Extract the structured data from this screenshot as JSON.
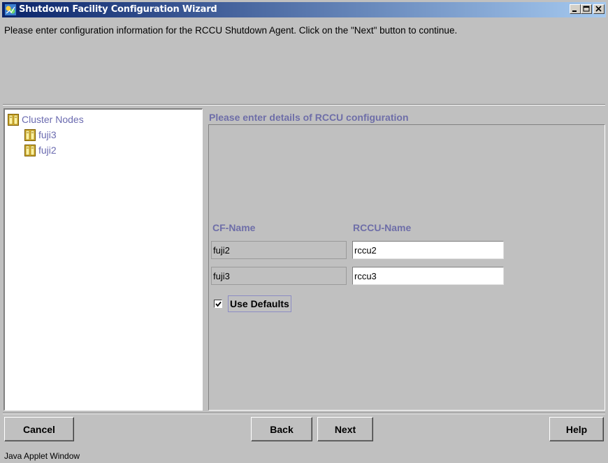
{
  "window": {
    "title": "Shutdown Facility Configuration Wizard",
    "icon": "wizard-app-icon",
    "controls": [
      "minimize-icon",
      "maximize-icon",
      "close-icon"
    ]
  },
  "instructions": "Please enter configuration information for the RCCU Shutdown Agent. Click on the \"Next\" button to continue.",
  "tree": {
    "root": "Cluster Nodes",
    "nodes": [
      "fuji3",
      "fuji2"
    ]
  },
  "details": {
    "header": "Please enter details of RCCU configuration",
    "cf_name_label": "CF-Name",
    "rccu_name_label": "RCCU-Name",
    "rows": [
      {
        "cf_name": "fuji2",
        "rccu_name": "rccu2"
      },
      {
        "cf_name": "fuji3",
        "rccu_name": "rccu3"
      }
    ],
    "use_defaults_label": "Use Defaults",
    "use_defaults_checked": true
  },
  "buttons": {
    "cancel": "Cancel",
    "back": "Back",
    "next": "Next",
    "help": "Help"
  },
  "status_bar": "Java Applet Window"
}
